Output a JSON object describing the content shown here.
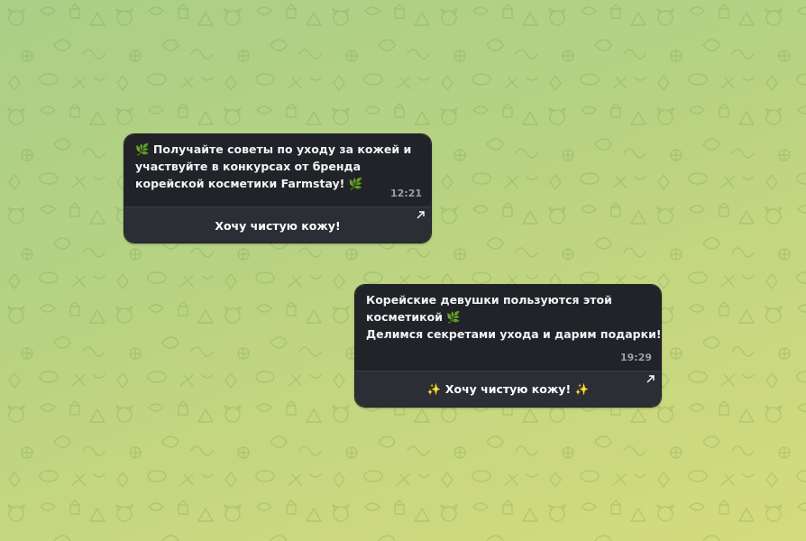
{
  "posts": [
    {
      "lines": [
        "🌿 Получайте советы по уходу за кожей и",
        "участвуйте в конкурсах от бренда",
        "корейской косметики Farmstay! 🌿"
      ],
      "time": "12:21",
      "button_label": "Хочу чистую кожу!"
    },
    {
      "lines": [
        "Корейские девушки пользуются этой",
        "косметикой 🌿",
        "Делимся секретами ухода и дарим подарки!"
      ],
      "time": "19:29",
      "button_label": "✨ Хочу чистую кожу! ✨"
    }
  ],
  "icons": {
    "external_link": "arrow-up-right-icon",
    "leaf": "herb-leaf-icon",
    "sparkles": "sparkles-icon"
  },
  "colors": {
    "bubble_bg": "#212328",
    "button_bg": "#2b2e34",
    "text": "#f1f2f4",
    "time": "#9aa0a8",
    "wallpaper_start": "#aacf86",
    "wallpaper_end": "#d4db7e"
  }
}
